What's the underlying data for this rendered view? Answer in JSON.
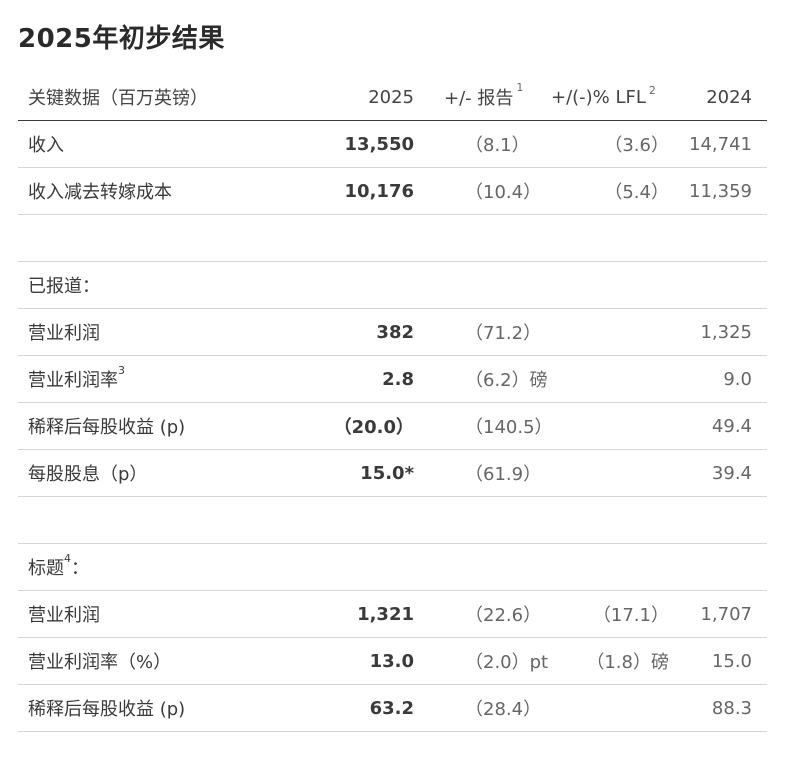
{
  "title": "2025年初步结果",
  "header": {
    "label": "关键数据（百万英镑）",
    "col_2025": "2025",
    "col_reported": "+/- 报告",
    "col_reported_note": "1",
    "col_lfl": "+/(-)% LFL",
    "col_lfl_note": "2",
    "col_2024": "2024"
  },
  "rows_top": [
    {
      "label": "收入",
      "v2025": "13,550",
      "reported": "（8.1）",
      "lfl": "（3.6）",
      "v2024": "14,741"
    },
    {
      "label": "收入减去转嫁成本",
      "v2025": "10,176",
      "reported": "（10.4）",
      "lfl": "（5.4）",
      "v2024": "11,359"
    }
  ],
  "section_reported": {
    "label": "已报道：",
    "rows": [
      {
        "label": "营业利润",
        "note": "",
        "v2025": "382",
        "reported": "（71.2）",
        "lfl": "",
        "v2024": "1,325"
      },
      {
        "label": "营业利润率",
        "note": "3",
        "v2025": "2.8",
        "reported": "（6.2）磅",
        "lfl": "",
        "v2024": "9.0"
      },
      {
        "label": "稀释后每股收益 (p)",
        "note": "",
        "v2025": "（20.0）",
        "reported": "（140.5）",
        "lfl": "",
        "v2024": "49.4"
      },
      {
        "label": "每股股息（p）",
        "note": "",
        "v2025": "15.0*",
        "reported": "（61.9）",
        "lfl": "",
        "v2024": "39.4"
      }
    ]
  },
  "section_headline": {
    "label": "标题",
    "note": "4",
    "label_suffix": "：",
    "rows": [
      {
        "label": "营业利润",
        "v2025": "1,321",
        "reported": "（22.6）",
        "lfl": "（17.1）",
        "v2024": "1,707"
      },
      {
        "label": "营业利润率（%）",
        "v2025": "13.0",
        "reported": "（2.0）pt",
        "lfl": "（1.8）磅",
        "v2024": "15.0"
      },
      {
        "label": "稀释后每股收益 (p)",
        "v2025": "63.2",
        "reported": "（28.4）",
        "lfl": "",
        "v2024": "88.3"
      }
    ]
  }
}
